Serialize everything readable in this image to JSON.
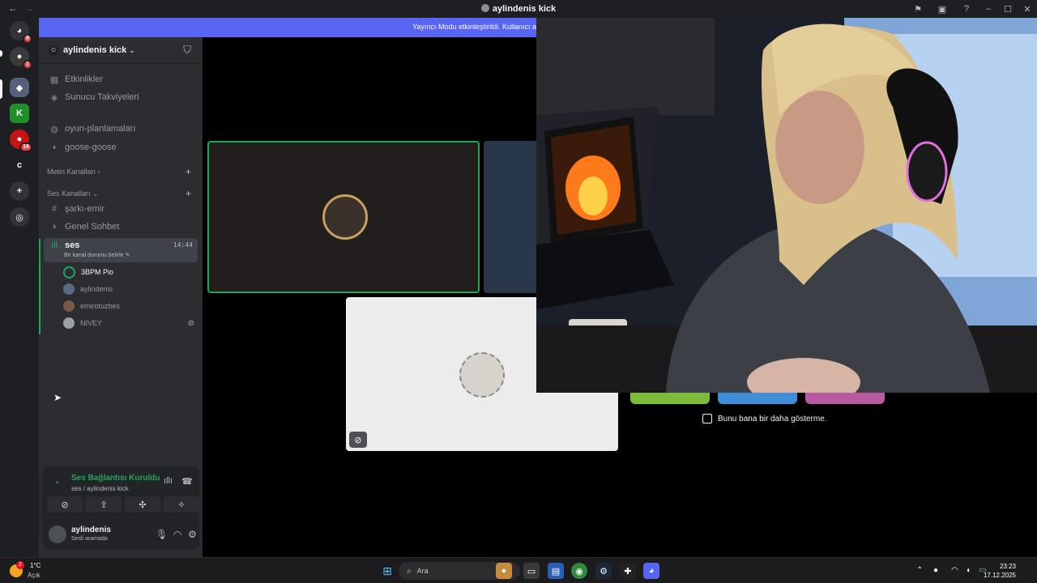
{
  "window": {
    "title": "aylindenis kick",
    "nav_back": "←",
    "nav_forward": "→"
  },
  "banner": {
    "text": "Yayıncı Modu etkinleştirildi. Kullanıcı a"
  },
  "rail": {
    "badges": [
      "9",
      "1",
      "16"
    ],
    "c_label": "c"
  },
  "server": {
    "name": "aylindenis kick",
    "icon_letter": "O"
  },
  "channels": {
    "top": [
      {
        "label": "Etkinlikler",
        "icon": "calendar-icon"
      },
      {
        "label": "Sunucu Takviyeleri",
        "icon": "boost-icon"
      }
    ],
    "pinned": [
      {
        "label": "oyun-planlamaları",
        "icon": "forum-icon"
      },
      {
        "label": "goose-goose",
        "icon": "speaker-icon"
      }
    ],
    "text_category": "Metin Kanalları",
    "voice_category": "Ses Kanalları",
    "voice": [
      {
        "label": "şarkı-emir",
        "icon": "hash-icon"
      },
      {
        "label": "Genel Sohbet",
        "icon": "speaker-icon"
      }
    ],
    "active": {
      "label": "ses",
      "time": "14:44",
      "status": "Bir kanal durumu belirle"
    },
    "voice_users": [
      {
        "name": "3BPM Pio",
        "speaking": true
      },
      {
        "name": "aylindenis",
        "speaking": false
      },
      {
        "name": "emirotuzbes",
        "speaking": false
      },
      {
        "name": "NIVEY",
        "speaking": false,
        "muted": true
      }
    ]
  },
  "voice_panel": {
    "status": "Ses Bağlantısı Kuruldu",
    "location": "ses / aylindenis kick"
  },
  "user": {
    "name": "aylindenis",
    "status": "Sesli aramada"
  },
  "popup": {
    "dont_show": "Bunu bana bir daha gösterme."
  },
  "taskbar": {
    "weather_temp": "1°C",
    "weather_cond": "Açık",
    "weather_badge": "2",
    "search_placeholder": "Ara",
    "time": "23:23",
    "date": "17.12.2025"
  },
  "colors": {
    "accent": "#5865f2",
    "green": "#23a559",
    "red": "#f23f43",
    "sidebar": "#2b2d31",
    "rail": "#1e1f22"
  }
}
